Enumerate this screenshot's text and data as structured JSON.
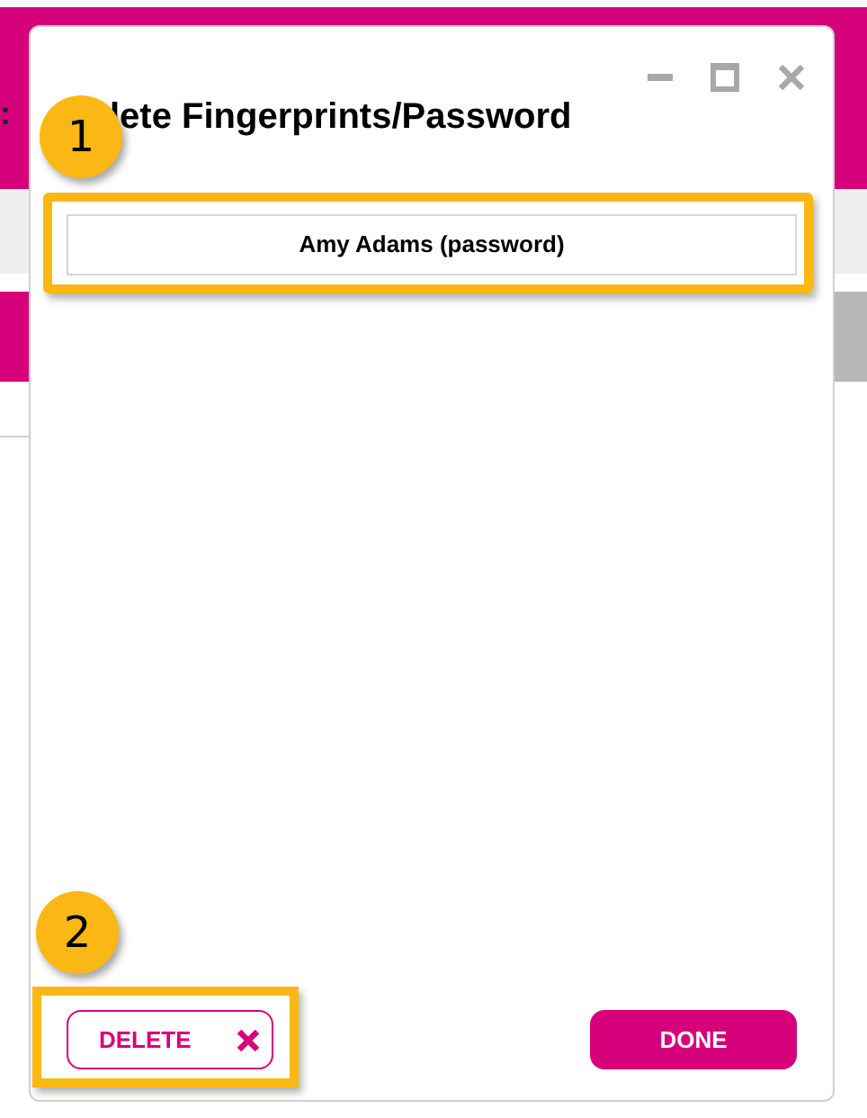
{
  "background": {
    "fragment": ":"
  },
  "dialog": {
    "title": "lete Fingerprints/Password",
    "items": [
      {
        "label": "Amy Adams (password)"
      }
    ],
    "buttons": [
      {
        "kind": "outline",
        "label": "DELETE"
      },
      {
        "kind": "filled",
        "label": "DONE"
      }
    ]
  },
  "callouts": [
    {
      "label": "1"
    },
    {
      "label": "2"
    }
  ]
}
